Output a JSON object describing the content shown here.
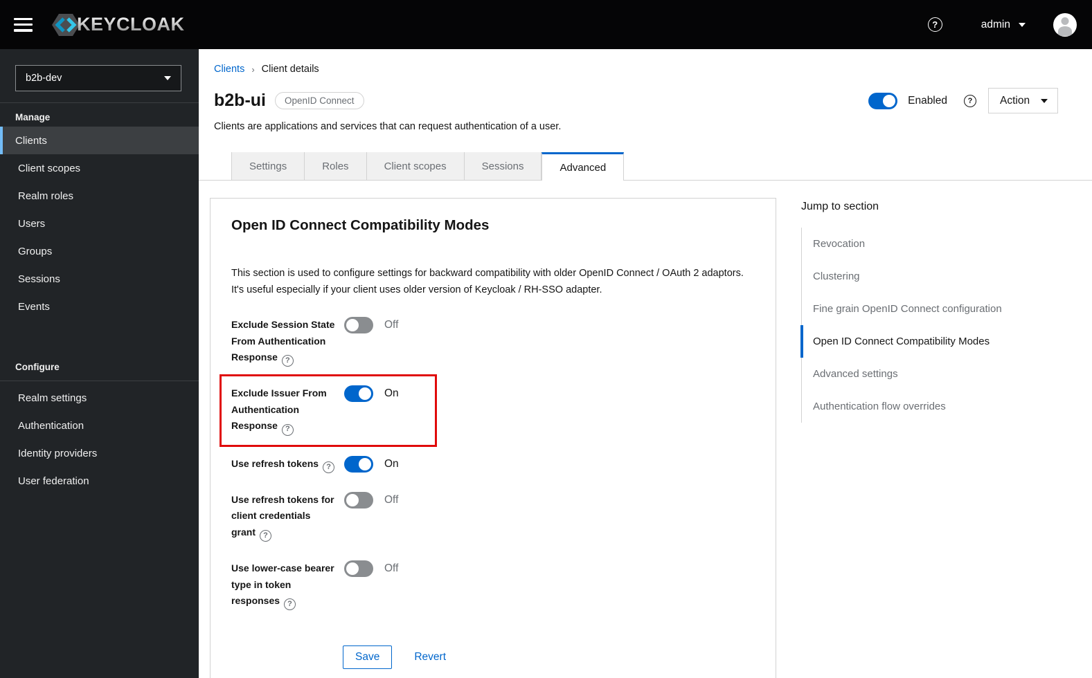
{
  "masthead": {
    "brand": "KEYCLOAK",
    "user": "admin"
  },
  "sidebar": {
    "realm": "b2b-dev",
    "sections": [
      {
        "label": "Manage",
        "items": [
          {
            "label": "Clients",
            "active": true
          },
          {
            "label": "Client scopes"
          },
          {
            "label": "Realm roles"
          },
          {
            "label": "Users"
          },
          {
            "label": "Groups"
          },
          {
            "label": "Sessions"
          },
          {
            "label": "Events"
          }
        ]
      },
      {
        "label": "Configure",
        "items": [
          {
            "label": "Realm settings"
          },
          {
            "label": "Authentication"
          },
          {
            "label": "Identity providers"
          },
          {
            "label": "User federation"
          }
        ]
      }
    ]
  },
  "breadcrumb": [
    "Clients",
    "Client details"
  ],
  "header": {
    "title": "b2b-ui",
    "badge": "OpenID Connect",
    "enabled_label": "Enabled",
    "action_label": "Action",
    "description": "Clients are applications and services that can request authentication of a user."
  },
  "tabs": [
    {
      "label": "Settings"
    },
    {
      "label": "Roles"
    },
    {
      "label": "Client scopes"
    },
    {
      "label": "Sessions"
    },
    {
      "label": "Advanced",
      "active": true
    }
  ],
  "panel": {
    "title": "Open ID Connect Compatibility Modes",
    "description": "This section is used to configure settings for backward compatibility with older OpenID Connect / OAuth 2 adaptors. It's useful especially if your client uses older version of Keycloak / RH-SSO adapter.",
    "rows": [
      {
        "label": "Exclude Session State From Authentication Response",
        "state": "Off",
        "on": false,
        "highlighted": false
      },
      {
        "label": "Exclude Issuer From Authentication Response",
        "state": "On",
        "on": true,
        "highlighted": true
      },
      {
        "label": "Use refresh tokens",
        "state": "On",
        "on": true,
        "highlighted": false
      },
      {
        "label": "Use refresh tokens for client credentials grant",
        "state": "Off",
        "on": false,
        "highlighted": false
      },
      {
        "label": "Use lower-case bearer type in token responses",
        "state": "Off",
        "on": false,
        "highlighted": false
      }
    ],
    "save_label": "Save",
    "revert_label": "Revert"
  },
  "jump": {
    "title": "Jump to section",
    "items": [
      {
        "label": "Revocation"
      },
      {
        "label": "Clustering"
      },
      {
        "label": "Fine grain OpenID Connect configuration"
      },
      {
        "label": "Open ID Connect Compatibility Modes",
        "active": true
      },
      {
        "label": "Advanced settings"
      },
      {
        "label": "Authentication flow overrides"
      }
    ]
  },
  "colors": {
    "accent": "#0066cc",
    "link": "#0066cc",
    "highlight": "#e00b0b",
    "toggle_off": "#8a8d90",
    "masthead_bg": "#050506",
    "sidebar_bg": "#212427",
    "sidebar_selected": "#3c3f42",
    "sidebar_selected_bar": "#73bcf7"
  }
}
